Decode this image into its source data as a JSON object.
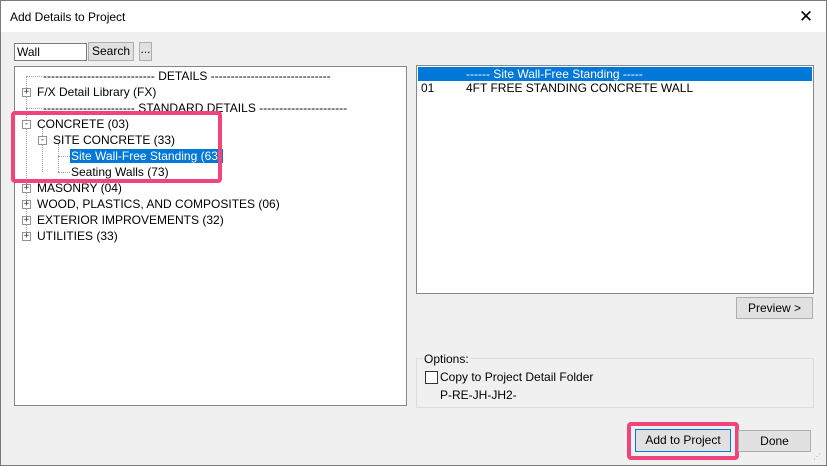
{
  "window": {
    "title": "Add Details to Project"
  },
  "search": {
    "value": "Wall",
    "button_label": "Search",
    "more_label": "..."
  },
  "tree": {
    "details_header": "---------------------------- DETAILS ------------------------------",
    "fx_library": "F/X Detail Library (FX)",
    "standard_header": "----------------------- STANDARD DETAILS ----------------------",
    "concrete": "CONCRETE (03)",
    "site_concrete": "SITE CONCRETE (33)",
    "site_wall": "Site Wall-Free Standing (63)",
    "seating_walls": "Seating Walls (73)",
    "masonry": "MASONRY (04)",
    "wood": "WOOD, PLASTICS, AND COMPOSITES (06)",
    "exterior": "EXTERIOR IMPROVEMENTS (32)",
    "utilities": "UTILITIES (33)",
    "collapsed_sign": "+",
    "expanded_sign": "-"
  },
  "details_list": {
    "header_row": "------ Site Wall-Free Standing -----",
    "rows": [
      {
        "number": "01",
        "name": "4FT FREE STANDING CONCRETE WALL"
      }
    ]
  },
  "preview": {
    "label": "Preview >"
  },
  "options": {
    "label": "Options:",
    "copy_checkbox_label": "Copy to Project Detail Folder",
    "copy_checked": false,
    "folder_path": "P-RE-JH-JH2-"
  },
  "footer": {
    "add_label": "Add to Project",
    "done_label": "Done"
  },
  "colors": {
    "highlight": "#f0447a",
    "selection": "#0078d7"
  }
}
